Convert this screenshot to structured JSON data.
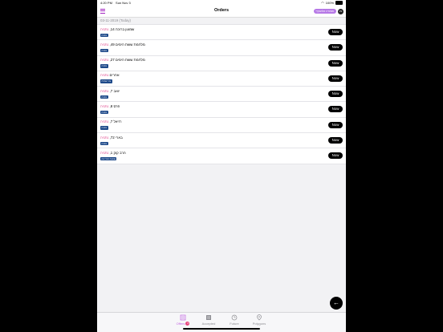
{
  "status_bar": {
    "time": "4:20 PM",
    "date": "Sun Nov 3",
    "battery": "100%"
  },
  "nav": {
    "title": "Orders",
    "pill_label": "מסעדה אלנשקיף",
    "avatar_text": "JS"
  },
  "date_header": "03-11-2019 (Today)",
  "orders": [
    {
      "street": "שמעון ברוכה 14,",
      "city": "נתניה",
      "tag": "נתניה",
      "action": "Now"
    },
    {
      "street": "מלחמת ששת הימים 49,",
      "city": "נתניה",
      "tag": "נתניה",
      "action": "Now"
    },
    {
      "street": "מלחמת ששת הימים 27,",
      "city": "נתניה",
      "tag": "נתניה",
      "action": "Now"
    },
    {
      "street": "אחרים",
      "city": "נתניה",
      "tag": "עיר אחרת",
      "action": "Now"
    },
    {
      "street": "יואב 7,",
      "city": "נתניה",
      "tag": "נתניה",
      "action": "Now"
    },
    {
      "street": "פרס 8,",
      "city": "נתניה",
      "tag": "נתניה",
      "action": "Now"
    },
    {
      "street": "רזיאל 7,",
      "city": "נתניה",
      "tag": "נתניה",
      "action": "Now"
    },
    {
      "street": "בארי 72,",
      "city": "נתניה",
      "tag": "נתניה",
      "action": "Now"
    },
    {
      "street": "הרב קוק 1,",
      "city": "נתניה",
      "tag": "שכונת הנרייטה",
      "action": "Now"
    }
  ],
  "fab_label": "←",
  "tabs": [
    {
      "label": "Offers",
      "badge": "3"
    },
    {
      "label": "Accepted"
    },
    {
      "label": "Future"
    },
    {
      "label": "Polygons"
    }
  ],
  "colors": {
    "accent": "#c060e0",
    "tag_bg": "#1f4a8a",
    "city": "#e0458c"
  }
}
